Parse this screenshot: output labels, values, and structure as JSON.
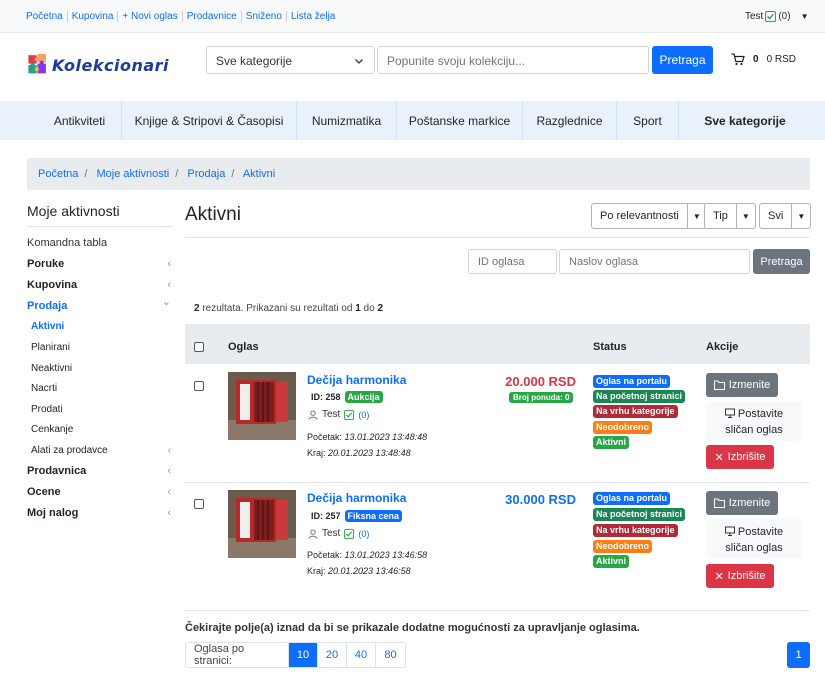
{
  "topbar": {
    "links": [
      "Početna",
      "Kupovina",
      "+ Novi oglas",
      "Prodavnice",
      "Sniženo",
      "Lista želja"
    ],
    "user": "Test",
    "user_count": "(0)"
  },
  "header": {
    "logo_text": "Kolekcionari",
    "category_select": "Sve kategorije",
    "search_placeholder": "Popunite svoju kolekciju...",
    "search_button": "Pretraga",
    "cart_count": "0",
    "cart_total": "0 RSD"
  },
  "categories": [
    "Antikviteti",
    "Knjige & Stripovi & Časopisi",
    "Numizmatika",
    "Poštanske markice",
    "Razglednice",
    "Sport",
    "Sve kategorije"
  ],
  "breadcrumb": [
    "Početna",
    "Moje aktivnosti",
    "Prodaja",
    "Aktivni"
  ],
  "sidebar": {
    "title": "Moje aktivnosti",
    "items": [
      {
        "label": "Komandna tabla"
      },
      {
        "label": "Poruke",
        "arrow": "‹"
      },
      {
        "label": "Kupovina",
        "arrow": "‹"
      },
      {
        "label": "Prodaja",
        "arrow": "⌄"
      },
      {
        "label": "Aktivni"
      },
      {
        "label": "Planirani"
      },
      {
        "label": "Neaktivni"
      },
      {
        "label": "Nacrti"
      },
      {
        "label": "Prodati"
      },
      {
        "label": "Cenkanje"
      },
      {
        "label": "Alati za prodavce",
        "arrow": "‹"
      },
      {
        "label": "Prodavnica",
        "arrow": "‹"
      },
      {
        "label": "Ocene",
        "arrow": "‹"
      },
      {
        "label": "Moj nalog",
        "arrow": "‹"
      }
    ]
  },
  "main": {
    "title": "Aktivni",
    "sort": "Po relevantnosti",
    "type_filter": "Tip",
    "all_filter": "Svi",
    "id_placeholder": "ID oglasa",
    "title_placeholder": "Naslov oglasa",
    "filter_button": "Pretraga",
    "results": {
      "count": "2",
      "text1": " rezultata. Prikazani su rezultati od ",
      "from": "1",
      "text2": " do ",
      "to": "2"
    },
    "columns": {
      "listing": "Oglas",
      "status": "Status",
      "actions": "Akcije"
    },
    "hint": "Čekirajte polje(a) iznad da bi se prikazale dodatne mogućnosti za upravljanje oglasima.",
    "per_page_label": "Oglasa po stranici:",
    "per_page_options": [
      "10",
      "20",
      "40",
      "80"
    ],
    "page": "1"
  },
  "listings": [
    {
      "title": "Dečija harmonika",
      "id": "ID: 258",
      "type": "Aukcija",
      "type_color": "#28a745",
      "seller": "Test",
      "seller_count": "(0)",
      "start_label": "Početak: ",
      "start": "13.01.2023 13:48:48",
      "end_label": "Kraj: ",
      "end": "20.01.2023 13:48:48",
      "price": "20.000 RSD",
      "price_color": "#dc3545",
      "bids": "Broj ponuda: 0",
      "statuses": [
        "Oglas na portalu",
        "Na početnoj stranici",
        "Na vrhu kategorije",
        "Neodobreno",
        "Aktivni"
      ]
    },
    {
      "title": "Dečija harmonika",
      "id": "ID: 257",
      "type": "Fiksna cena",
      "type_color": "#0d6efd",
      "seller": "Test",
      "seller_count": "(0)",
      "start_label": "Početak: ",
      "start": "13.01.2023 13:46:58",
      "end_label": "Kraj: ",
      "end": "20.01.2023 13:46:58",
      "price": "30.000 RSD",
      "price_color": "#0d6efd",
      "statuses": [
        "Oglas na portalu",
        "Na početnoj stranici",
        "Na vrhu kategorije",
        "Neodobreno",
        "Aktivni"
      ]
    }
  ],
  "actions": {
    "edit": "Izmenite",
    "similar_line1": "Postavite",
    "similar_line2": "sličan oglas",
    "delete": "Izbrišite"
  },
  "status_colors": [
    "#0d6efd",
    "#198754",
    "#b02a37",
    "#fd7e14",
    "#28a745"
  ],
  "colors": {
    "primary": "#0d6efd",
    "danger": "#dc3545",
    "secondary": "#6c757d"
  }
}
